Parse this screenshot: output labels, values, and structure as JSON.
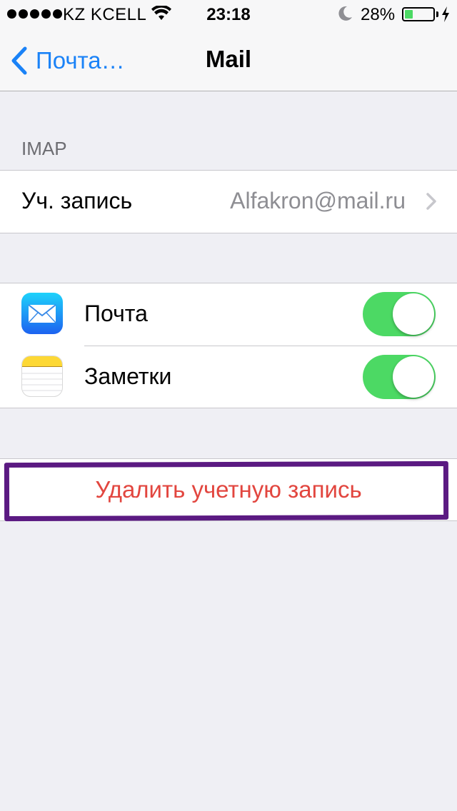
{
  "status_bar": {
    "carrier": "KZ KCELL",
    "time": "23:18",
    "battery_percent": "28%",
    "battery_level": 0.28,
    "icons": [
      "signal-dots-icon",
      "wifi-icon",
      "moon-icon",
      "battery-icon",
      "charging-bolt-icon"
    ]
  },
  "nav": {
    "back_label": "Почта…",
    "title": "Mail"
  },
  "section": {
    "header": "IMAP"
  },
  "account": {
    "label": "Уч. запись",
    "value": "Alfakron@mail.ru"
  },
  "services": [
    {
      "label": "Почта",
      "icon": "mail-app-icon",
      "enabled": true
    },
    {
      "label": "Заметки",
      "icon": "notes-app-icon",
      "enabled": true
    }
  ],
  "delete_button": {
    "label": "Удалить учетную запись",
    "color": "#e2463f"
  },
  "colors": {
    "accent": "#1a82f7",
    "toggle_on": "#4cd964",
    "highlight": "#5b1a82",
    "background": "#efeff4"
  }
}
